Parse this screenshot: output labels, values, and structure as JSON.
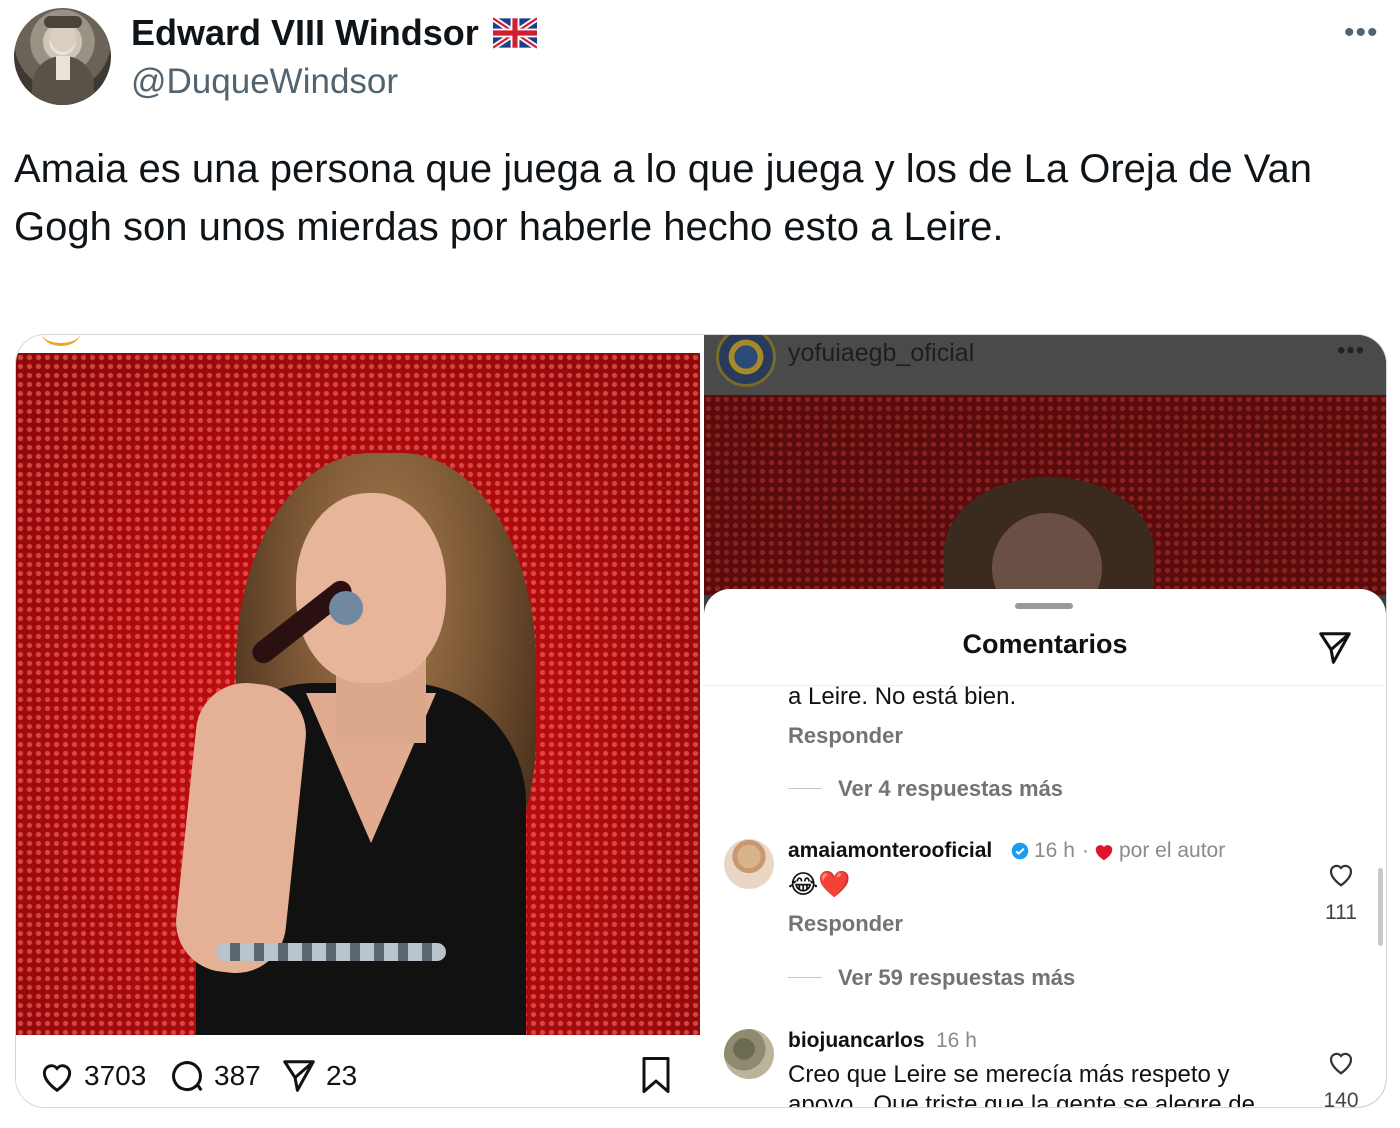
{
  "tweet": {
    "author_name": "Edward VIII Windsor",
    "author_handle": "@DuqueWindsor",
    "more_icon": "more-icon",
    "text": "Amaia es una persona que juega a lo que juega y los de La Oreja de Van Gogh son unos mierdas por haberle hecho esto a Leire."
  },
  "left_post": {
    "likes": "3703",
    "comments": "387",
    "shares": "23"
  },
  "right_post": {
    "username": "yofuiaegb_oficial",
    "sheet_title": "Comentarios",
    "prev_comment_tail": "a Leire. No está bien.",
    "reply_label": "Responder",
    "prev_more_replies": "Ver 4 respuestas más",
    "comments": [
      {
        "user": "amaiamonterooficial",
        "time": "16 h",
        "author_badge": "por el autor",
        "text": "😂❤️",
        "reply_label": "Responder",
        "likes": "111",
        "more_replies": "Ver 59 respuestas más"
      },
      {
        "user": "biojuancarlos",
        "time": "16 h",
        "text_line1": "Creo que Leire se merecía más respeto y",
        "text_line2": "apoyo . Que triste que la gente se alegre de",
        "likes": "140"
      }
    ]
  },
  "colors": {
    "primary_text": "#0f1419",
    "secondary_text": "#536471",
    "border": "#cfd9de",
    "stage_red": "#d40f12",
    "verified_blue": "#1d9bf0",
    "heart_red": "#e0142c"
  }
}
